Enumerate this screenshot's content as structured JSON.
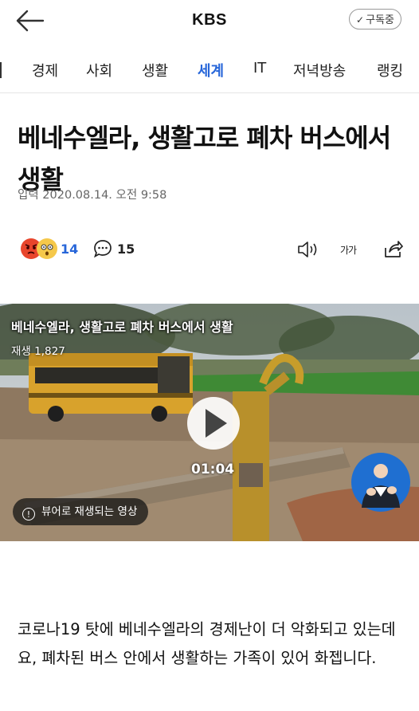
{
  "header": {
    "brand": "KBS",
    "subscribe_label": "구독중"
  },
  "tabs": [
    {
      "label": "경제"
    },
    {
      "label": "사회"
    },
    {
      "label": "생활"
    },
    {
      "label": "세계",
      "active": true
    },
    {
      "label": "IT"
    },
    {
      "label": "저녁방송"
    },
    {
      "label": "랭킹"
    }
  ],
  "article": {
    "headline": "베네수엘라, 생활고로 폐차 버스에서 생활",
    "byline": "입력 2020.08.14. 오전 9:58",
    "reaction_count": "14",
    "comment_count": "15",
    "font_size_label": "가가",
    "lead": "코로나19 탓에 베네수엘라의 경제난이 더 악화되고 있는데요, 폐차된 버스 안에서 생활하는 가족이 있어 화젭니다."
  },
  "video": {
    "title": "베네수엘라, 생활고로 폐차 버스에서 생활",
    "views": "재생 1,827",
    "duration": "01:04",
    "viewer_notice": "뷰어로 재생되는 영상"
  },
  "colors": {
    "accent": "#2766d9",
    "text": "#111111",
    "muted": "#666666"
  }
}
